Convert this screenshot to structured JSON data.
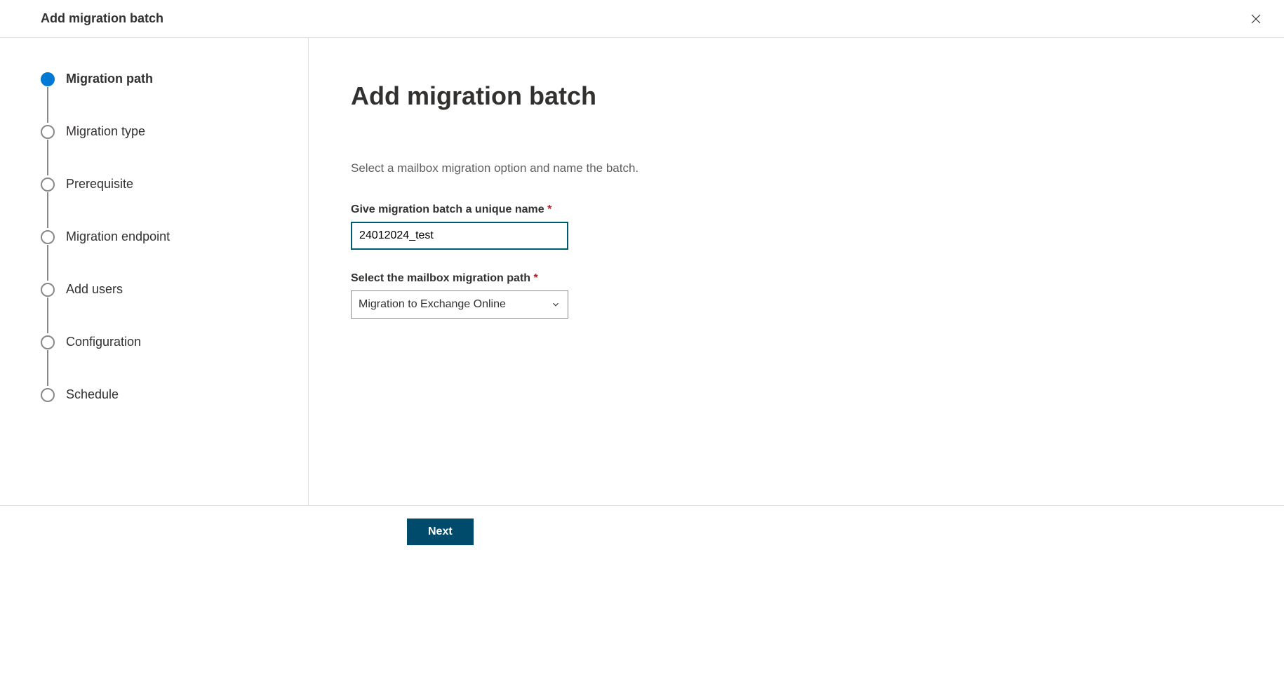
{
  "header": {
    "title": "Add migration batch"
  },
  "steps": [
    {
      "label": "Migration path",
      "active": true
    },
    {
      "label": "Migration type",
      "active": false
    },
    {
      "label": "Prerequisite",
      "active": false
    },
    {
      "label": "Migration endpoint",
      "active": false
    },
    {
      "label": "Add users",
      "active": false
    },
    {
      "label": "Configuration",
      "active": false
    },
    {
      "label": "Schedule",
      "active": false
    }
  ],
  "main": {
    "title": "Add migration batch",
    "description": "Select a mailbox migration option and name the batch.",
    "name_label": "Give migration batch a unique name",
    "name_value": "24012024_test",
    "path_label": "Select the mailbox migration path",
    "path_value": "Migration to Exchange Online"
  },
  "footer": {
    "next_label": "Next"
  }
}
